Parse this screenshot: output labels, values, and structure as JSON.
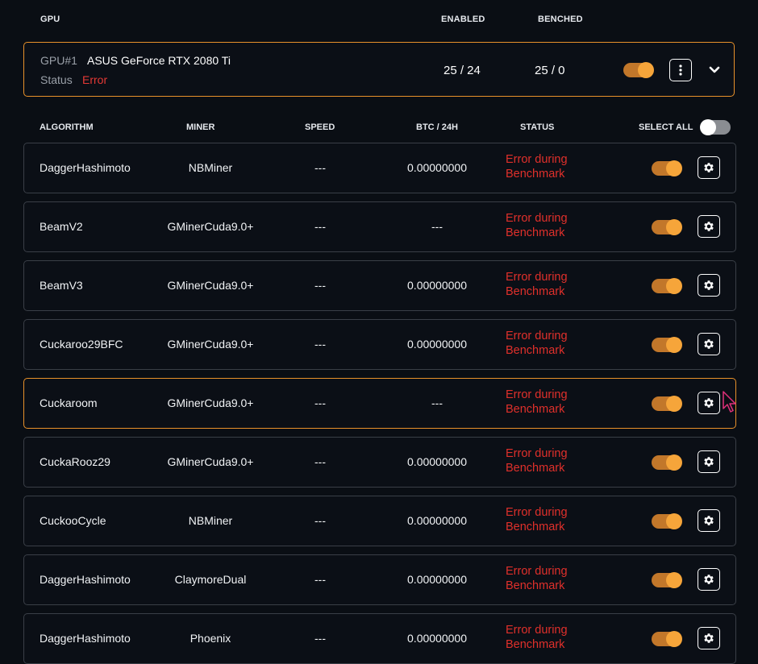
{
  "header": {
    "gpu": "GPU",
    "enabled": "ENABLED",
    "benched": "BENCHED"
  },
  "device": {
    "id": "GPU#1",
    "name": "ASUS GeForce RTX 2080 Ti",
    "status_label": "Status",
    "status_value": "Error",
    "enabled": "25 / 24",
    "benched": "25 / 0",
    "toggle_on": true
  },
  "columns": {
    "algorithm": "ALGORITHM",
    "miner": "MINER",
    "speed": "SPEED",
    "btc": "BTC / 24H",
    "status": "STATUS",
    "select_all": "SELECT ALL",
    "select_all_on": false
  },
  "rows": [
    {
      "algorithm": "DaggerHashimoto",
      "miner": "NBMiner",
      "speed": "---",
      "btc": "0.00000000",
      "status1": "Error during",
      "status2": "Benchmark"
    },
    {
      "algorithm": "BeamV2",
      "miner": "GMinerCuda9.0+",
      "speed": "---",
      "btc": "---",
      "status1": "Error during",
      "status2": "Benchmark"
    },
    {
      "algorithm": "BeamV3",
      "miner": "GMinerCuda9.0+",
      "speed": "---",
      "btc": "0.00000000",
      "status1": "Error during",
      "status2": "Benchmark"
    },
    {
      "algorithm": "Cuckaroo29BFC",
      "miner": "GMinerCuda9.0+",
      "speed": "---",
      "btc": "0.00000000",
      "status1": "Error during",
      "status2": "Benchmark"
    },
    {
      "algorithm": "Cuckaroom",
      "miner": "GMinerCuda9.0+",
      "speed": "---",
      "btc": "---",
      "status1": "Error during",
      "status2": "Benchmark"
    },
    {
      "algorithm": "CuckaRooz29",
      "miner": "GMinerCuda9.0+",
      "speed": "---",
      "btc": "0.00000000",
      "status1": "Error during",
      "status2": "Benchmark"
    },
    {
      "algorithm": "CuckooCycle",
      "miner": "NBMiner",
      "speed": "---",
      "btc": "0.00000000",
      "status1": "Error during",
      "status2": "Benchmark"
    },
    {
      "algorithm": "DaggerHashimoto",
      "miner": "ClaymoreDual",
      "speed": "---",
      "btc": "0.00000000",
      "status1": "Error during",
      "status2": "Benchmark"
    },
    {
      "algorithm": "DaggerHashimoto",
      "miner": "Phoenix",
      "speed": "---",
      "btc": "0.00000000",
      "status1": "Error during",
      "status2": "Benchmark"
    }
  ],
  "colors": {
    "accent": "#e8912a",
    "error": "#e0302b",
    "background": "#0a0e14"
  },
  "icons": {
    "more": "vertical-dots-icon",
    "expand": "chevron-down-icon",
    "settings": "gear-icon"
  }
}
